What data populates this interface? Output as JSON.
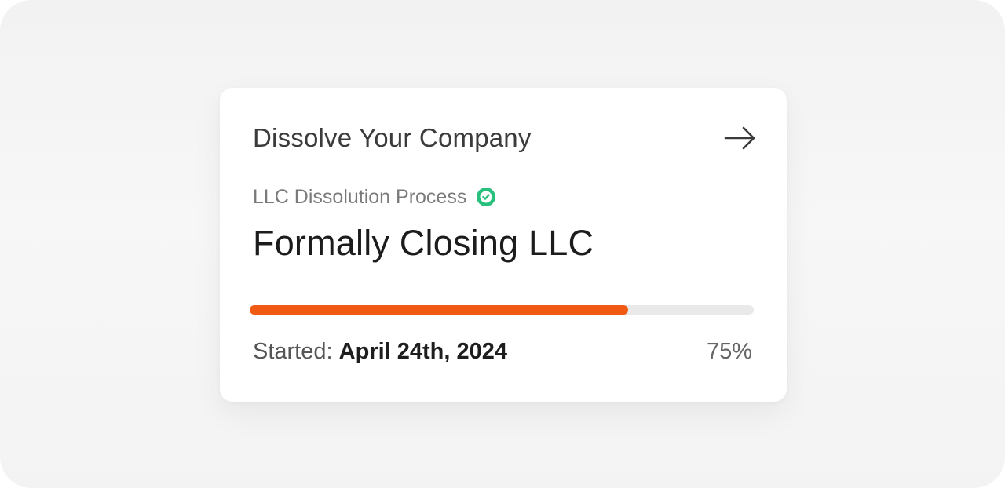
{
  "card": {
    "title": "Dissolve Your Company",
    "arrow_icon": "arrow-right-icon",
    "subtitle": "LLC Dissolution Process",
    "check_icon": "check-circle-icon",
    "heading": "Formally Closing LLC",
    "started_label": "Started:",
    "started_date": "April 24th, 2024",
    "progress_percent": 75,
    "progress_text": "75%"
  },
  "colors": {
    "progress_fill": "#f05a12",
    "progress_track": "#e9e9e9",
    "check_green": "#27c07d"
  }
}
